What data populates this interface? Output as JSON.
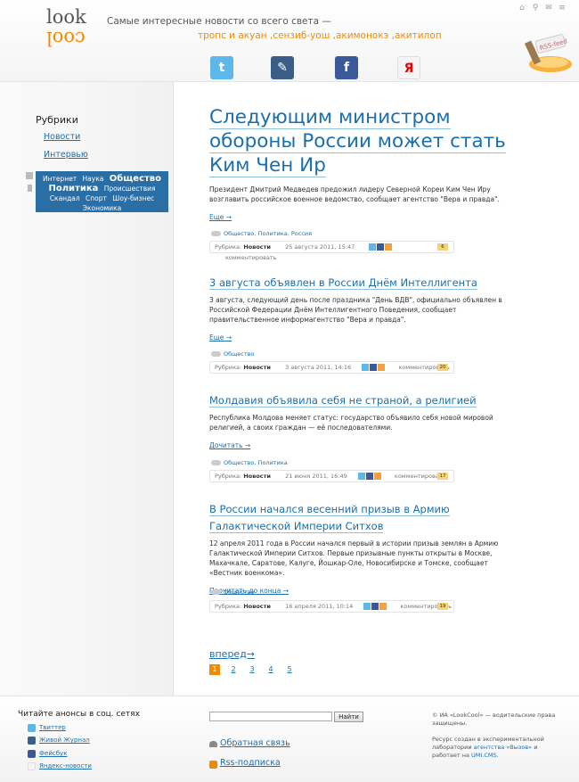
{
  "header": {
    "logo_top": "look",
    "logo_bottom": "cool",
    "tagline": "Самые интересные новости со всего света —",
    "tagline_sub": "тропс и акуан ,сензиб-уош ,акимонокэ ,акитилоп",
    "rss_label": "RSS-feed",
    "top_icons": [
      "home-icon",
      "search-icon",
      "mail-icon",
      "sitemap-icon"
    ],
    "social": {
      "twitter": "t",
      "livejournal": "✎",
      "facebook": "f",
      "yandex": "Я"
    }
  },
  "sidebar": {
    "title": "Рубрики",
    "items": [
      {
        "label": "Новости"
      },
      {
        "label": "Интервью"
      }
    ],
    "tags_line1": [
      "Интернет",
      "Наука"
    ],
    "tags_line1_big": "Общество",
    "tags_line2_big": "Политика",
    "tags_line2": [
      "Происшествия"
    ],
    "tags_line3": [
      "Скандал",
      "Спорт",
      "Шоу-бизнес"
    ],
    "tags_line4": [
      "Экономика"
    ]
  },
  "articles": [
    {
      "title": "Следующим министром обороны России может стать Ким Чен Ир",
      "body": "Президент Дмитрий Медведев предожил лидеру Северной Кореи Ким Чен Иру возглавить российское военное ведомство, сообщает агентство \"Вера и правда\".",
      "more": "Еще →",
      "cats": [
        "Общество",
        "Политика",
        "Россия"
      ],
      "rubric_label": "Рубрика:",
      "rubric": "Новости",
      "date": "25 августа 2011, 15:47",
      "comment": "комментировать",
      "count": "6"
    },
    {
      "title": "3 августа объявлен в России Днём Интеллигента",
      "body": "3 августа, следующий день после праздника \"День ВДВ\", официально объявлен в Российской Федерации Днём Интеллигентного Поведения, сообщает правительственное информагентство \"Вера и правда\".",
      "more": "Еще →",
      "cats": [
        "Общество"
      ],
      "rubric_label": "Рубрика:",
      "rubric": "Новости",
      "date": "3 августа 2011, 14:16",
      "comment": "комментировать",
      "count": "20"
    },
    {
      "title": "Молдавия объявила себя не страной, а религией",
      "body": "Республика Молдова меняет статус: государство объявило себя новой мировой религией, а своих граждан — её последователями.",
      "more": "Дочитать →",
      "cats": [
        "Общество",
        "Политика"
      ],
      "rubric_label": "Рубрика:",
      "rubric": "Новости",
      "date": "21 июня 2011, 16:49",
      "comment": "комментировать",
      "count": "17"
    },
    {
      "title": "В России начался весенний призыв в Армию Галактической Империи Ситхов",
      "body": "12 апреля 2011 года в России начался первый в истории призыв землян в Армию Галактической Империи Ситхов. Первые призывные пункты открыты в Москве, Махачкале, Саратове, Калуге, Йошкар-Оле, Новосибирске и Томске, сообщает «Вестник военкома».",
      "more": "Прочитать до конца →",
      "cats": [
        "Общество"
      ],
      "rubric_label": "Рубрика:",
      "rubric": "Новости",
      "date": "16 апреля 2011, 10:14",
      "comment": "комментировать",
      "count": "19"
    }
  ],
  "pager": {
    "next": "вперед→",
    "pages": [
      "1",
      "2",
      "3",
      "4",
      "5"
    ],
    "current": "1"
  },
  "footer": {
    "social_title": "Читайте анонсы в соц. сетях",
    "social_links": [
      "Твиттер",
      "Живой Журнал",
      "Фейсбук",
      "Яндекс-новости"
    ],
    "search_button": "Найти",
    "feedback": "Обратная связь",
    "rss": "Rss-подписка",
    "copyright": "© ИА «LookCool» — водительские права защищены.",
    "resource_pre": "Ресурс создан в экспериментальной лаборатории",
    "agency_link": "агентства «Вызов»",
    "resource_mid": "и работает на",
    "cms_link": "UMI.CMS",
    "dot": "."
  },
  "colors": {
    "accent": "#f28a00",
    "link": "#1a6fb0",
    "tagbox": "#2a6ea6"
  }
}
